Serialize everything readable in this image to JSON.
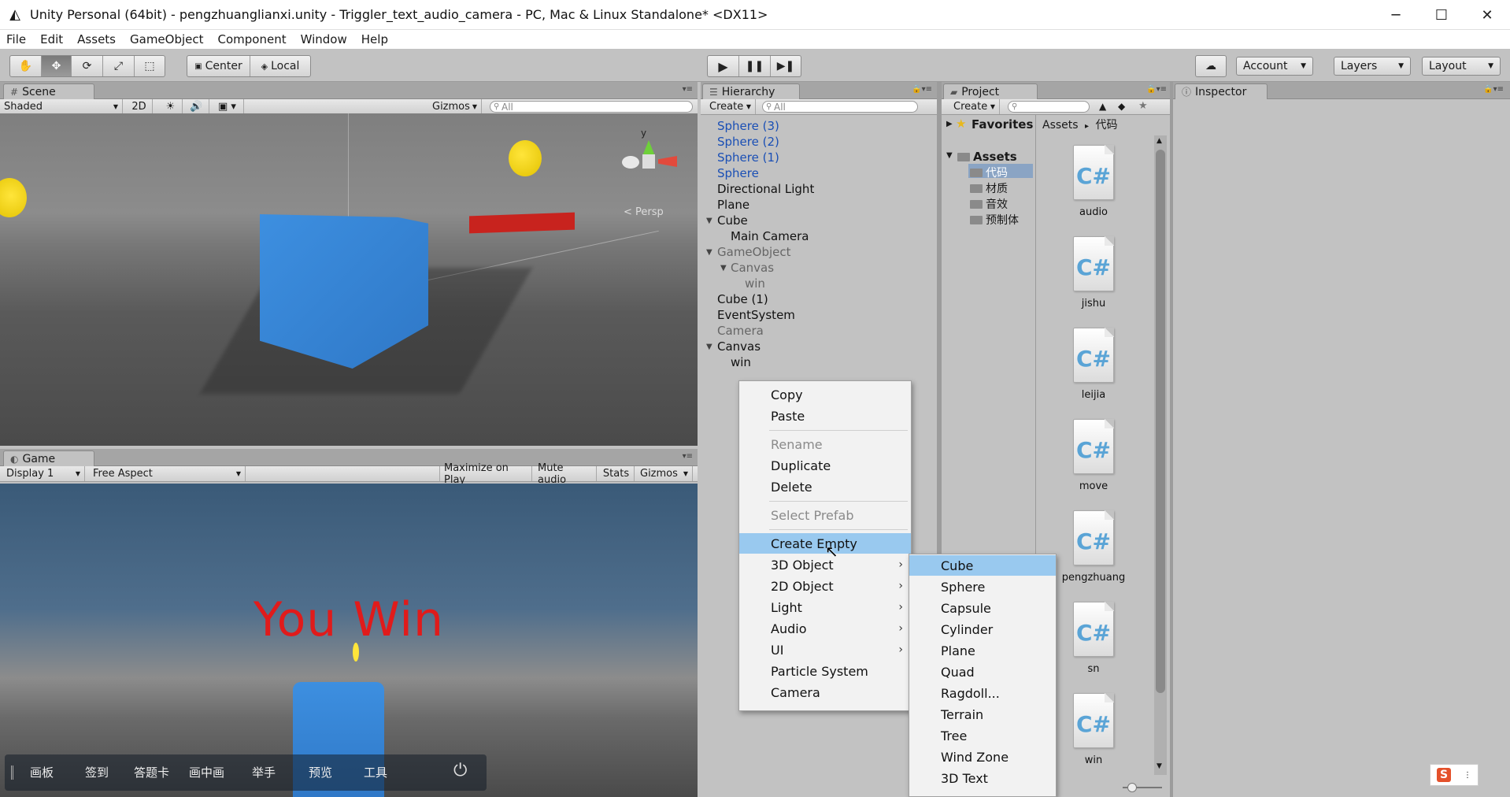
{
  "window": {
    "title": "Unity Personal (64bit) - pengzhuanglianxi.unity - Triggler_text_audio_camera - PC, Mac & Linux Standalone* <DX11>",
    "controls": [
      "─",
      "☐",
      "✕"
    ]
  },
  "menu": [
    "File",
    "Edit",
    "Assets",
    "GameObject",
    "Component",
    "Window",
    "Help"
  ],
  "toolbar": {
    "tools": [
      "hand",
      "move",
      "rotate",
      "scale",
      "rect"
    ],
    "pivot": "Center",
    "space": "Local",
    "account": "Account",
    "layers": "Layers",
    "layout": "Layout"
  },
  "scene": {
    "tab": "Scene",
    "shading": "Shaded",
    "mode2d": "2D",
    "gizmos": "Gizmos",
    "search_placeholder": "All",
    "persp_label": "< Persp",
    "axis_y": "y"
  },
  "game": {
    "tab": "Game",
    "display": "Display 1",
    "aspect": "Free Aspect",
    "maximize": "Maximize on Play",
    "mute": "Mute audio",
    "stats": "Stats",
    "gizmos": "Gizmos",
    "win_text": "You Win"
  },
  "hierarchy": {
    "tab": "Hierarchy",
    "create": "Create",
    "search_placeholder": "All",
    "items": [
      {
        "label": "Sphere (3)"
      },
      {
        "label": "Sphere (2)"
      },
      {
        "label": "Sphere (1)"
      },
      {
        "label": "Sphere"
      },
      {
        "label": "Directional Light"
      },
      {
        "label": "Plane"
      },
      {
        "label": "Cube"
      },
      {
        "label": "Main Camera"
      },
      {
        "label": "GameObject"
      },
      {
        "label": "Canvas"
      },
      {
        "label": "win"
      },
      {
        "label": "Cube (1)"
      },
      {
        "label": "EventSystem"
      },
      {
        "label": "Camera"
      },
      {
        "label": "Canvas"
      },
      {
        "label": "win"
      }
    ]
  },
  "context_menu": {
    "items": [
      "Copy",
      "Paste",
      "Rename",
      "Duplicate",
      "Delete",
      "Select Prefab",
      "Create Empty",
      "3D Object",
      "2D Object",
      "Light",
      "Audio",
      "UI",
      "Particle System",
      "Camera"
    ],
    "submenu": [
      "Cube",
      "Sphere",
      "Capsule",
      "Cylinder",
      "Plane",
      "Quad",
      "Ragdoll...",
      "Terrain",
      "Tree",
      "Wind Zone",
      "3D Text"
    ]
  },
  "project": {
    "tab": "Project",
    "create": "Create",
    "favorites": "Favorites",
    "breadcrumb_root": "Assets",
    "breadcrumb_sep": "▸",
    "breadcrumb_current": "代码",
    "tree_root": "Assets",
    "folders": [
      "代码",
      "材质",
      "音效",
      "预制体"
    ],
    "files": [
      "audio",
      "jishu",
      "leijia",
      "move",
      "pengzhuang",
      "sn",
      "win"
    ],
    "cs_glyph": "C#"
  },
  "inspector": {
    "tab": "Inspector"
  },
  "overlay_bar": {
    "items": [
      "画板",
      "签到",
      "答题卡",
      "画中画",
      "举手",
      "预览",
      "工具"
    ]
  },
  "ime": {
    "label": "S"
  }
}
